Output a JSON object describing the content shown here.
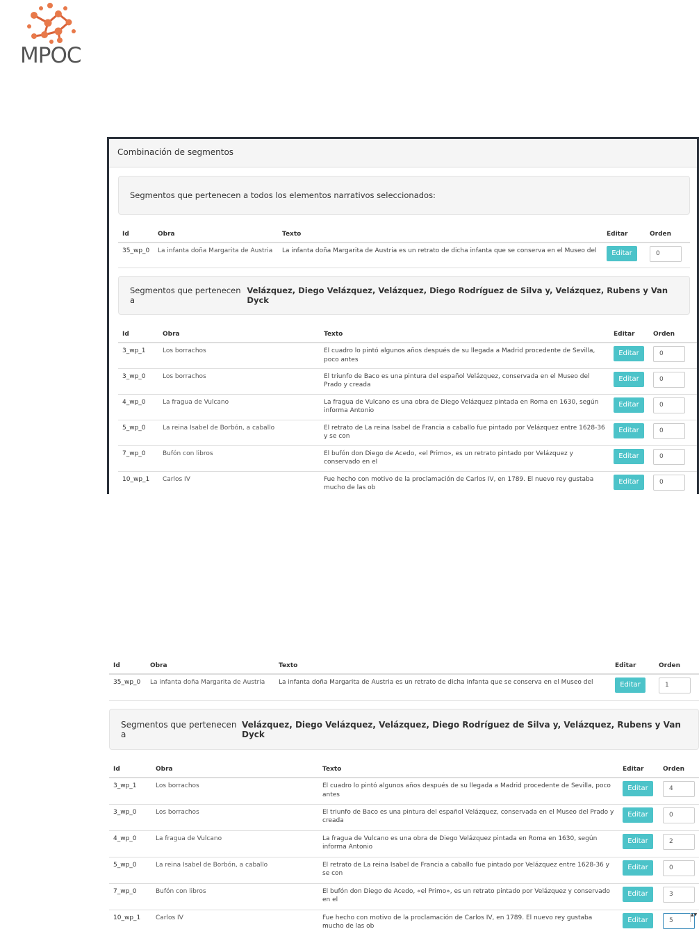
{
  "logo": {
    "text": "MPOC",
    "dot_color": "#e8794a",
    "link_color": "#d9623a"
  },
  "panel": {
    "title": "Combinación de segmentos",
    "common_heading": "Segmentos que pertenecen a todos los elementos narrativos seleccionados:",
    "group_heading_prefix": "Segmentos que pertenecen a ",
    "group_heading_bold": "Velázquez, Diego Velázquez, Velázquez, Diego Rodríguez de Silva y, Velázquez, Rubens y Van Dyck"
  },
  "columns": {
    "id": "Id",
    "obra": "Obra",
    "texto": "Texto",
    "editar": "Editar",
    "orden": "Orden"
  },
  "edit_label": "Editar",
  "common_rows_before": [
    {
      "id": "35_wp_0",
      "obra": "La infanta doña Margarita de Austria",
      "texto": "La infanta doña Margarita de Austria es un retrato de dicha infanta que se conserva en el Museo del",
      "orden": "0"
    }
  ],
  "group_rows_before": [
    {
      "id": "3_wp_1",
      "obra": "Los borrachos",
      "texto": "El cuadro lo pintó algunos años después de su llegada a Madrid procedente de Sevilla, poco antes",
      "orden": "0"
    },
    {
      "id": "3_wp_0",
      "obra": "Los borrachos",
      "texto": "El triunfo de Baco es una pintura del español Velázquez, conservada en el Museo del Prado y creada",
      "orden": "0"
    },
    {
      "id": "4_wp_0",
      "obra": "La fragua de Vulcano",
      "texto": "La fragua de Vulcano es una obra de Diego Velázquez pintada en Roma en 1630, según informa Antonio",
      "orden": "0"
    },
    {
      "id": "5_wp_0",
      "obra": "La reina Isabel de Borbón, a caballo",
      "texto": "El retrato de La reina Isabel de Francia a caballo fue pintado por Velázquez entre 1628-36 y se con",
      "orden": "0"
    },
    {
      "id": "7_wp_0",
      "obra": "Bufón con libros",
      "texto": "El bufón don Diego de Acedo, «el Primo», es un retrato pintado por Velázquez y conservado en el",
      "orden": "0"
    },
    {
      "id": "10_wp_1",
      "obra": "Carlos IV",
      "texto": "Fue hecho con motivo de la proclamación de Carlos IV, en 1789. El nuevo rey gustaba mucho de las ob",
      "orden": "0"
    }
  ],
  "common_rows_after": [
    {
      "id": "35_wp_0",
      "obra": "La infanta doña Margarita de Austria",
      "texto": "La infanta doña Margarita de Austria es un retrato de dicha infanta que se conserva en el Museo del",
      "orden": "1"
    }
  ],
  "group_rows_after": [
    {
      "id": "3_wp_1",
      "obra": "Los borrachos",
      "texto": "El cuadro lo pintó algunos años después de su llegada a Madrid procedente de Sevilla, poco antes",
      "orden": "4"
    },
    {
      "id": "3_wp_0",
      "obra": "Los borrachos",
      "texto": "El triunfo de Baco es una pintura del español Velázquez, conservada en el Museo del Prado y creada",
      "orden": "0"
    },
    {
      "id": "4_wp_0",
      "obra": "La fragua de Vulcano",
      "texto": "La fragua de Vulcano es una obra de Diego Velázquez pintada en Roma en 1630, según informa Antonio",
      "orden": "2"
    },
    {
      "id": "5_wp_0",
      "obra": "La reina Isabel de Borbón, a caballo",
      "texto": "El retrato de La reina Isabel de Francia a caballo fue pintado por Velázquez entre 1628-36 y se con",
      "orden": "0"
    },
    {
      "id": "7_wp_0",
      "obra": "Bufón con libros",
      "texto": "El bufón don Diego de Acedo, «el Primo», es un retrato pintado por Velázquez y conservado en el",
      "orden": "3"
    },
    {
      "id": "10_wp_1",
      "obra": "Carlos IV",
      "texto": "Fue hecho con motivo de la proclamación de Carlos IV, en 1789. El nuevo rey gustaba mucho de las ob",
      "orden": "5"
    }
  ]
}
